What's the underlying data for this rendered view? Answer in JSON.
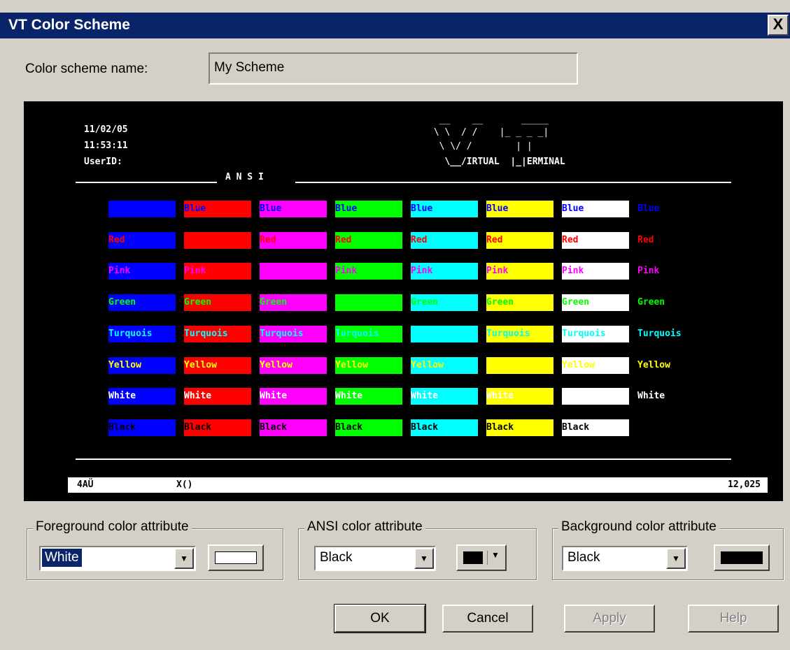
{
  "window": {
    "title": "VT Color Scheme",
    "close": "X"
  },
  "scheme_name": {
    "label": "Color scheme name:",
    "value": "My Scheme"
  },
  "preview": {
    "date": "11/02/05",
    "time": "11:53:11",
    "user_label": "UserID:",
    "section_label": "A N S I",
    "logo_line1": "  __    __       _____",
    "logo_line2": " \\ \\  / /    |_ _ _ _|",
    "logo_line3": "  \\ \\/ /        | |",
    "logo_line4": "   \\__/IRTUAL  |_|ERMINAL",
    "status_left": "4AÜ",
    "status_mid": "X()",
    "status_right": "12,025",
    "rows": [
      {
        "text": "Blue",
        "color": "#0000ff"
      },
      {
        "text": "Red",
        "color": "#ff0000"
      },
      {
        "text": "Pink",
        "color": "#ff00ff"
      },
      {
        "text": "Green",
        "color": "#00ff00"
      },
      {
        "text": "Turquois",
        "color": "#00ffff"
      },
      {
        "text": "Yellow",
        "color": "#ffff00"
      },
      {
        "text": "White",
        "color": "#ffffff"
      },
      {
        "text": "Black",
        "color": "#000000"
      }
    ],
    "backgrounds": [
      "#0000ff",
      "#ff0000",
      "#ff00ff",
      "#00ff00",
      "#00ffff",
      "#ffff00",
      "#ffffff",
      "#000000"
    ]
  },
  "foreground": {
    "title": "Foreground color attribute",
    "value": "White",
    "swatch_color": "#ffffff"
  },
  "ansi": {
    "title": "ANSI color attribute",
    "value": "Black",
    "swatch_color": "#000000"
  },
  "background": {
    "title": "Background color attribute",
    "value": "Black",
    "swatch_color": "#000000"
  },
  "buttons": {
    "ok": "OK",
    "cancel": "Cancel",
    "apply": "Apply",
    "help": "Help"
  }
}
